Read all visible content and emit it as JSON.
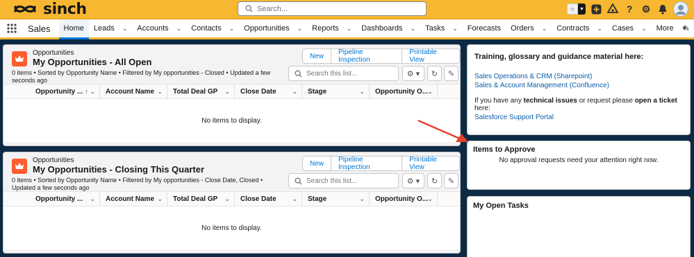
{
  "header": {
    "brand": "sinch",
    "search_placeholder": "Search..."
  },
  "nav": {
    "app_name": "Sales",
    "items": [
      {
        "label": "Home",
        "active": true
      },
      {
        "label": "Leads"
      },
      {
        "label": "Accounts"
      },
      {
        "label": "Contacts"
      },
      {
        "label": "Opportunities"
      },
      {
        "label": "Reports"
      },
      {
        "label": "Dashboards"
      },
      {
        "label": "Tasks"
      },
      {
        "label": "Forecasts"
      },
      {
        "label": "Orders"
      },
      {
        "label": "Contracts"
      },
      {
        "label": "Cases"
      },
      {
        "label": "More"
      }
    ]
  },
  "lists": [
    {
      "object_label": "Opportunities",
      "title": "My Opportunities - All Open",
      "meta": "0 items • Sorted by Opportunity Name • Filtered by My opportunities - Closed • Updated a few seconds ago",
      "buttons": [
        "New",
        "Pipeline Inspection",
        "Printable View"
      ],
      "search_placeholder": "Search this list...",
      "columns": [
        "Opportunity ...",
        "Account Name",
        "Total Deal GP",
        "Close Date",
        "Stage",
        "Opportunity O..."
      ],
      "empty_text": "No items to display."
    },
    {
      "object_label": "Opportunities",
      "title": "My Opportunities - Closing This Quarter",
      "meta": "0 items • Sorted by Opportunity Name • Filtered by My opportunities - Close Date, Closed • Updated a few seconds ago",
      "buttons": [
        "New",
        "Pipeline Inspection",
        "Printable View"
      ],
      "search_placeholder": "Search this list...",
      "columns": [
        "Opportunity ...",
        "Account Name",
        "Total Deal GP",
        "Close Date",
        "Stage",
        "Opportunity O..."
      ],
      "empty_text": "No items to display."
    }
  ],
  "training": {
    "title": "Training, glossary and guidance material here:",
    "link1": "Sales Operations & CRM (Sharepoint)",
    "link2": "Sales & Account Management (Confluence)",
    "text_a": "If you have any ",
    "text_b": "technical issues",
    "text_c": " or request please ",
    "text_d": "open a ticket",
    "text_e": " here:",
    "link3": "Salesforce Support Portal"
  },
  "approve": {
    "title": "Items to Approve",
    "message": "No approval requests need your attention right now."
  },
  "tasks": {
    "title": "My Open Tasks"
  },
  "colors": {
    "header": "#f7b731",
    "accent_blue": "#0176d3",
    "crown_orange": "#ff5d2d",
    "background": "#0d2a45",
    "arrow": "#e8412f"
  }
}
